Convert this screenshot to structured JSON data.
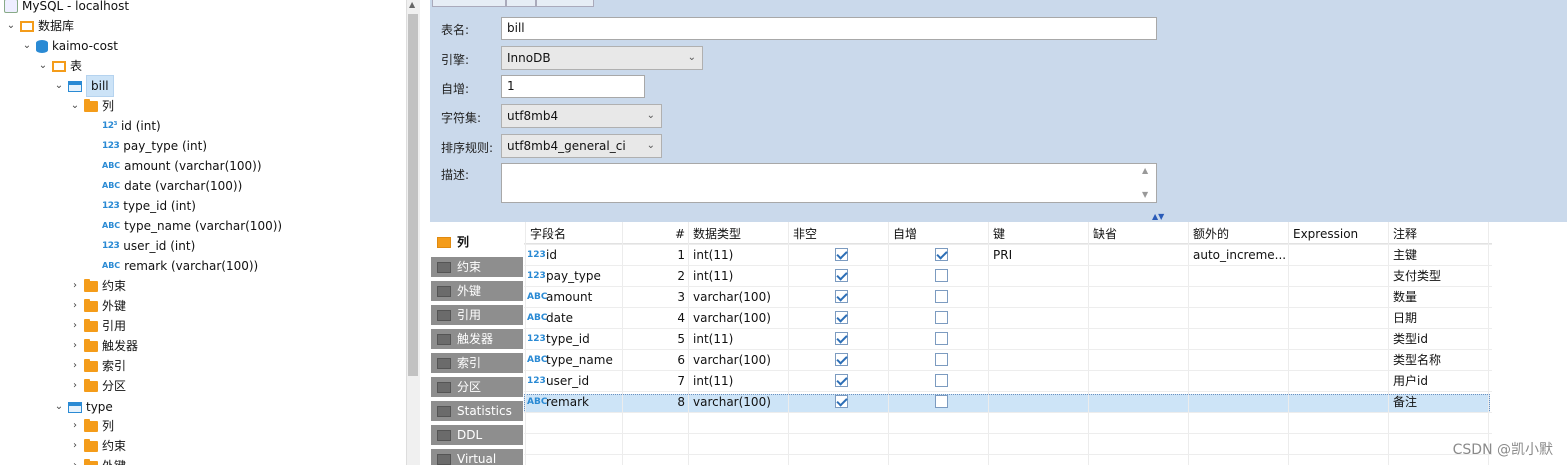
{
  "tree": {
    "host": "MySQL - localhost",
    "databases_label": "数据库",
    "db": "kaimo-cost",
    "tables_label": "表",
    "table1": "bill",
    "columns_label": "列",
    "columns": [
      {
        "type": "num",
        "label": "id (int)",
        "key": true
      },
      {
        "type": "num",
        "label": "pay_type (int)"
      },
      {
        "type": "abc",
        "label": "amount (varchar(100))"
      },
      {
        "type": "abc",
        "label": "date (varchar(100))"
      },
      {
        "type": "num",
        "label": "type_id (int)"
      },
      {
        "type": "abc",
        "label": "type_name (varchar(100))"
      },
      {
        "type": "num",
        "label": "user_id (int)"
      },
      {
        "type": "abc",
        "label": "remark (varchar(100))"
      }
    ],
    "table1_children": [
      "约束",
      "外键",
      "引用",
      "触发器",
      "索引",
      "分区"
    ],
    "table2": "type",
    "table2_children": [
      "列",
      "约束",
      "外键"
    ]
  },
  "form": {
    "name_label": "表名:",
    "name_value": "bill",
    "engine_label": "引擎:",
    "engine_value": "InnoDB",
    "autoinc_label": "自增:",
    "autoinc_value": "1",
    "charset_label": "字符集:",
    "charset_value": "utf8mb4",
    "collation_label": "排序规则:",
    "collation_value": "utf8mb4_general_ci",
    "desc_label": "描述:",
    "desc_value": ""
  },
  "side_tabs": [
    "列",
    "约束",
    "外键",
    "引用",
    "触发器",
    "索引",
    "分区",
    "Statistics",
    "DDL",
    "Virtual"
  ],
  "grid": {
    "headers": [
      "字段名",
      "#",
      "数据类型",
      "非空",
      "自增",
      "键",
      "缺省",
      "额外的",
      "Expression",
      "注释"
    ],
    "rows": [
      {
        "name": "id",
        "num": "1",
        "type": "int(11)",
        "notnull": true,
        "autoinc": true,
        "key": "PRI",
        "default": "",
        "extra": "auto_increme...",
        "expr": "",
        "comment": "主键",
        "icon": "num"
      },
      {
        "name": "pay_type",
        "num": "2",
        "type": "int(11)",
        "notnull": true,
        "autoinc": false,
        "key": "",
        "default": "",
        "extra": "",
        "expr": "",
        "comment": "支付类型",
        "icon": "num"
      },
      {
        "name": "amount",
        "num": "3",
        "type": "varchar(100)",
        "notnull": true,
        "autoinc": false,
        "key": "",
        "default": "",
        "extra": "",
        "expr": "",
        "comment": "数量",
        "icon": "abc"
      },
      {
        "name": "date",
        "num": "4",
        "type": "varchar(100)",
        "notnull": true,
        "autoinc": false,
        "key": "",
        "default": "",
        "extra": "",
        "expr": "",
        "comment": "日期",
        "icon": "abc"
      },
      {
        "name": "type_id",
        "num": "5",
        "type": "int(11)",
        "notnull": true,
        "autoinc": false,
        "key": "",
        "default": "",
        "extra": "",
        "expr": "",
        "comment": "类型id",
        "icon": "num"
      },
      {
        "name": "type_name",
        "num": "6",
        "type": "varchar(100)",
        "notnull": true,
        "autoinc": false,
        "key": "",
        "default": "",
        "extra": "",
        "expr": "",
        "comment": "类型名称",
        "icon": "abc"
      },
      {
        "name": "user_id",
        "num": "7",
        "type": "int(11)",
        "notnull": true,
        "autoinc": false,
        "key": "",
        "default": "",
        "extra": "",
        "expr": "",
        "comment": "用户id",
        "icon": "num"
      },
      {
        "name": "remark",
        "num": "8",
        "type": "varchar(100)",
        "notnull": true,
        "autoinc": false,
        "key": "",
        "default": "",
        "extra": "",
        "expr": "",
        "comment": "备注",
        "icon": "abc",
        "selected": true
      }
    ]
  },
  "watermark": "CSDN @凯小默"
}
